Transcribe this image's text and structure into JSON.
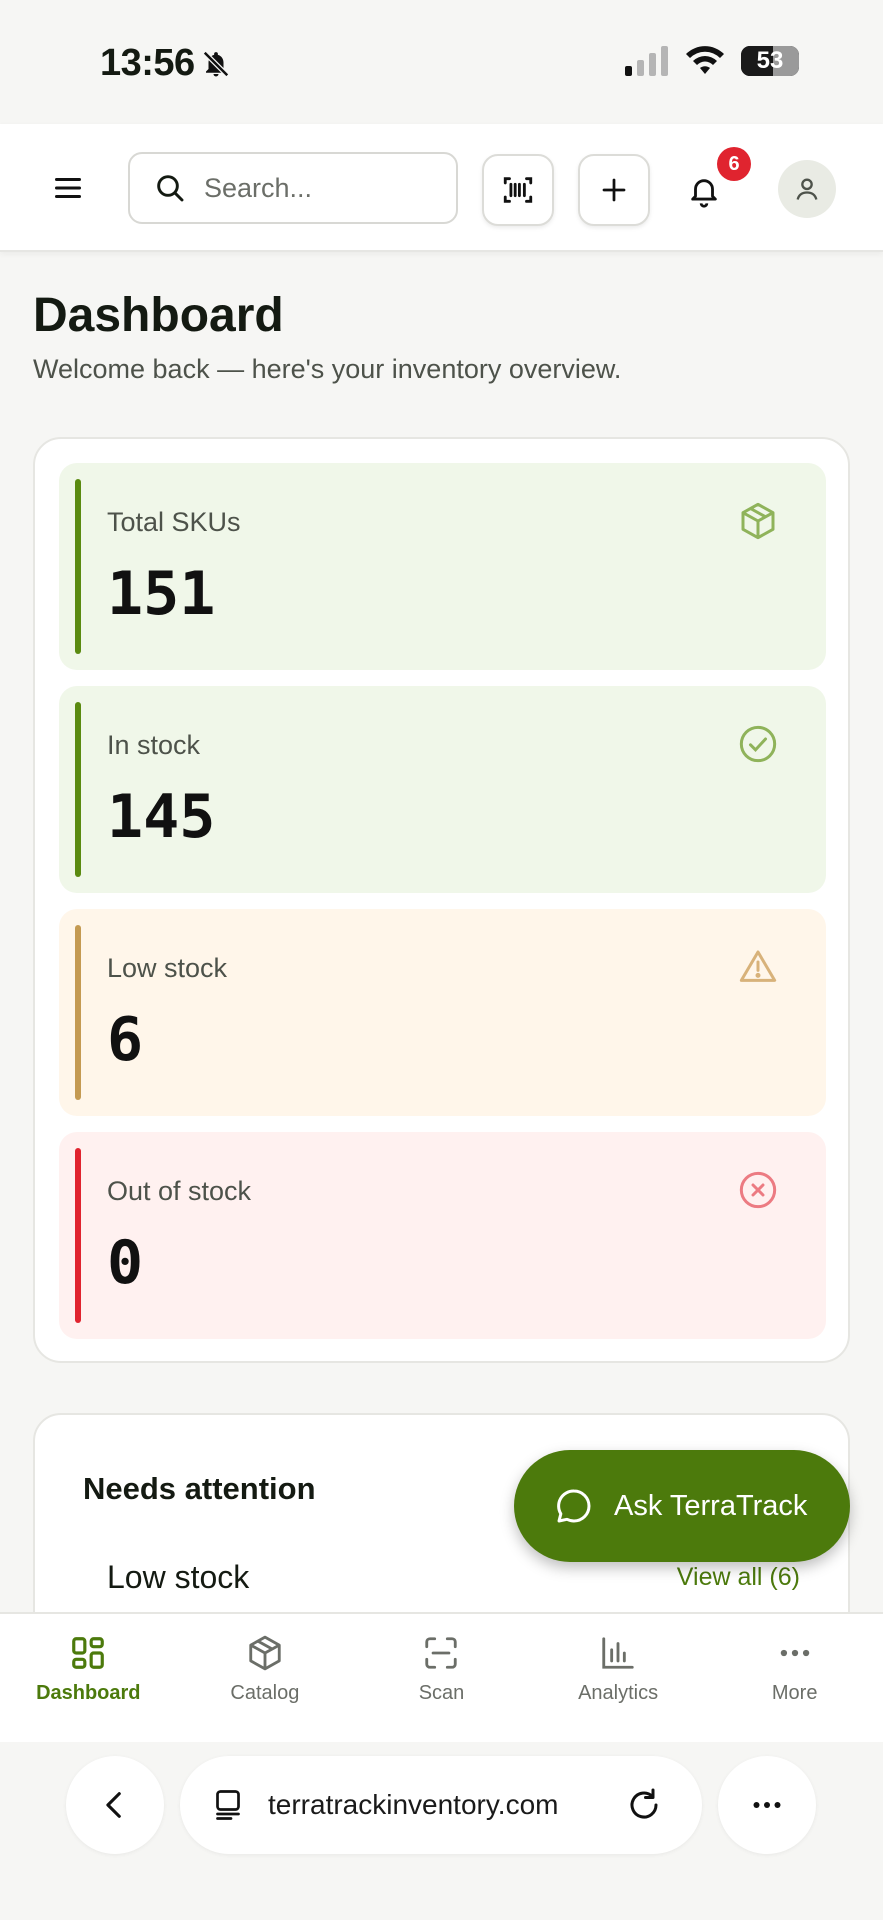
{
  "status_bar": {
    "time": "13:56",
    "battery": "53"
  },
  "header": {
    "search_placeholder": "Search...",
    "notifications_count": "6"
  },
  "main": {
    "title": "Dashboard",
    "subtitle": "Welcome back — here's your inventory overview."
  },
  "stats": [
    {
      "label": "Total SKUs",
      "value": "151",
      "icon": "box-icon"
    },
    {
      "label": "In stock",
      "value": "145",
      "icon": "check-circle-icon"
    },
    {
      "label": "Low stock",
      "value": "6",
      "icon": "warning-icon"
    },
    {
      "label": "Out of stock",
      "value": "0",
      "icon": "x-circle-icon"
    }
  ],
  "attention": {
    "title": "Needs attention",
    "section": "Low stock",
    "view_all": "View all (6)"
  },
  "fab": {
    "label": "Ask TerraTrack"
  },
  "bottom_nav": [
    {
      "label": "Dashboard",
      "active": true
    },
    {
      "label": "Catalog"
    },
    {
      "label": "Scan"
    },
    {
      "label": "Analytics"
    },
    {
      "label": "More"
    }
  ],
  "browser": {
    "url": "terratrackinventory.com"
  },
  "colors": {
    "brand_green": "#4c7a0c",
    "green_bar": "#5a8a10",
    "amber_bar": "#c49a52",
    "red_bar": "#e0242f",
    "badge_red": "#e0242f"
  }
}
